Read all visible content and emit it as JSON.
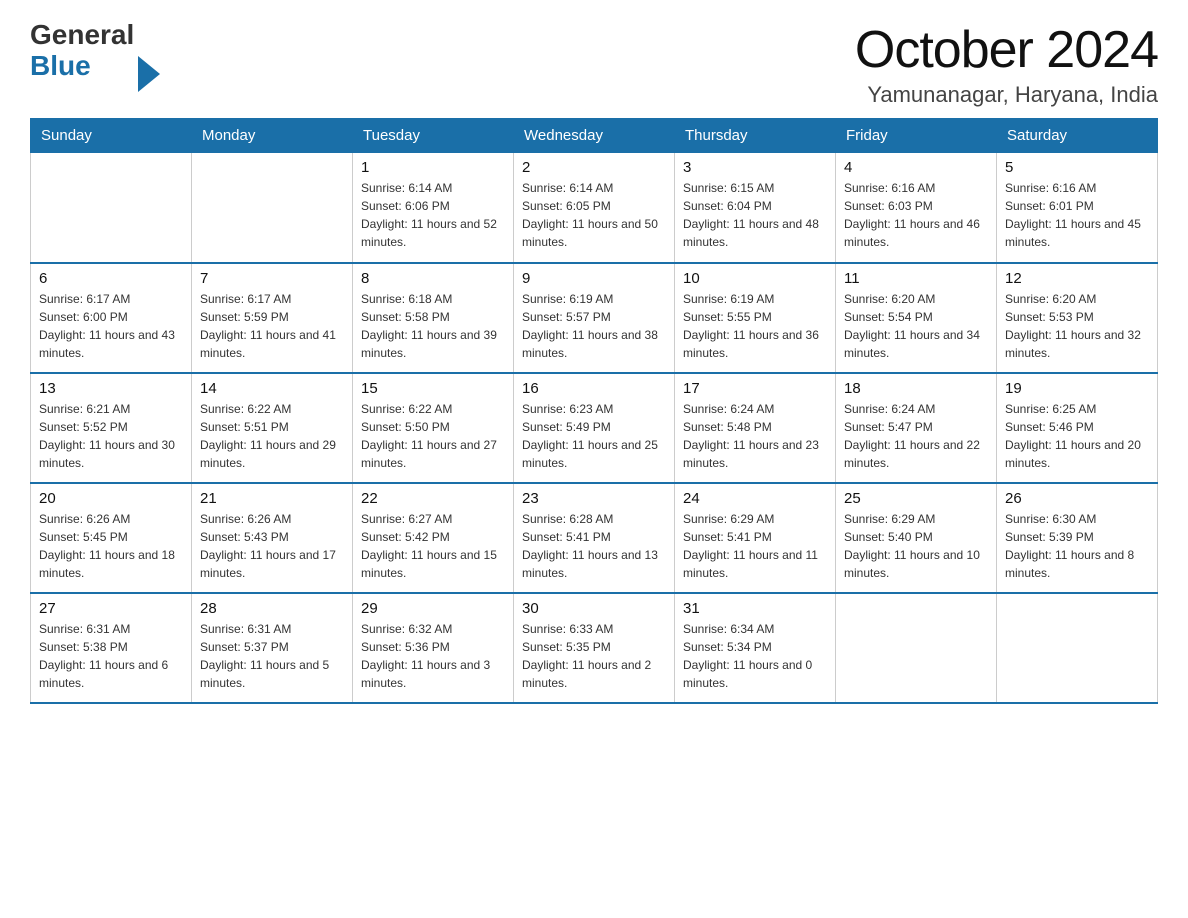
{
  "logo": {
    "general": "General",
    "blue": "Blue"
  },
  "title": "October 2024",
  "location": "Yamunanagar, Haryana, India",
  "weekdays": [
    "Sunday",
    "Monday",
    "Tuesday",
    "Wednesday",
    "Thursday",
    "Friday",
    "Saturday"
  ],
  "weeks": [
    [
      {
        "day": "",
        "sunrise": "",
        "sunset": "",
        "daylight": ""
      },
      {
        "day": "",
        "sunrise": "",
        "sunset": "",
        "daylight": ""
      },
      {
        "day": "1",
        "sunrise": "Sunrise: 6:14 AM",
        "sunset": "Sunset: 6:06 PM",
        "daylight": "Daylight: 11 hours and 52 minutes."
      },
      {
        "day": "2",
        "sunrise": "Sunrise: 6:14 AM",
        "sunset": "Sunset: 6:05 PM",
        "daylight": "Daylight: 11 hours and 50 minutes."
      },
      {
        "day": "3",
        "sunrise": "Sunrise: 6:15 AM",
        "sunset": "Sunset: 6:04 PM",
        "daylight": "Daylight: 11 hours and 48 minutes."
      },
      {
        "day": "4",
        "sunrise": "Sunrise: 6:16 AM",
        "sunset": "Sunset: 6:03 PM",
        "daylight": "Daylight: 11 hours and 46 minutes."
      },
      {
        "day": "5",
        "sunrise": "Sunrise: 6:16 AM",
        "sunset": "Sunset: 6:01 PM",
        "daylight": "Daylight: 11 hours and 45 minutes."
      }
    ],
    [
      {
        "day": "6",
        "sunrise": "Sunrise: 6:17 AM",
        "sunset": "Sunset: 6:00 PM",
        "daylight": "Daylight: 11 hours and 43 minutes."
      },
      {
        "day": "7",
        "sunrise": "Sunrise: 6:17 AM",
        "sunset": "Sunset: 5:59 PM",
        "daylight": "Daylight: 11 hours and 41 minutes."
      },
      {
        "day": "8",
        "sunrise": "Sunrise: 6:18 AM",
        "sunset": "Sunset: 5:58 PM",
        "daylight": "Daylight: 11 hours and 39 minutes."
      },
      {
        "day": "9",
        "sunrise": "Sunrise: 6:19 AM",
        "sunset": "Sunset: 5:57 PM",
        "daylight": "Daylight: 11 hours and 38 minutes."
      },
      {
        "day": "10",
        "sunrise": "Sunrise: 6:19 AM",
        "sunset": "Sunset: 5:55 PM",
        "daylight": "Daylight: 11 hours and 36 minutes."
      },
      {
        "day": "11",
        "sunrise": "Sunrise: 6:20 AM",
        "sunset": "Sunset: 5:54 PM",
        "daylight": "Daylight: 11 hours and 34 minutes."
      },
      {
        "day": "12",
        "sunrise": "Sunrise: 6:20 AM",
        "sunset": "Sunset: 5:53 PM",
        "daylight": "Daylight: 11 hours and 32 minutes."
      }
    ],
    [
      {
        "day": "13",
        "sunrise": "Sunrise: 6:21 AM",
        "sunset": "Sunset: 5:52 PM",
        "daylight": "Daylight: 11 hours and 30 minutes."
      },
      {
        "day": "14",
        "sunrise": "Sunrise: 6:22 AM",
        "sunset": "Sunset: 5:51 PM",
        "daylight": "Daylight: 11 hours and 29 minutes."
      },
      {
        "day": "15",
        "sunrise": "Sunrise: 6:22 AM",
        "sunset": "Sunset: 5:50 PM",
        "daylight": "Daylight: 11 hours and 27 minutes."
      },
      {
        "day": "16",
        "sunrise": "Sunrise: 6:23 AM",
        "sunset": "Sunset: 5:49 PM",
        "daylight": "Daylight: 11 hours and 25 minutes."
      },
      {
        "day": "17",
        "sunrise": "Sunrise: 6:24 AM",
        "sunset": "Sunset: 5:48 PM",
        "daylight": "Daylight: 11 hours and 23 minutes."
      },
      {
        "day": "18",
        "sunrise": "Sunrise: 6:24 AM",
        "sunset": "Sunset: 5:47 PM",
        "daylight": "Daylight: 11 hours and 22 minutes."
      },
      {
        "day": "19",
        "sunrise": "Sunrise: 6:25 AM",
        "sunset": "Sunset: 5:46 PM",
        "daylight": "Daylight: 11 hours and 20 minutes."
      }
    ],
    [
      {
        "day": "20",
        "sunrise": "Sunrise: 6:26 AM",
        "sunset": "Sunset: 5:45 PM",
        "daylight": "Daylight: 11 hours and 18 minutes."
      },
      {
        "day": "21",
        "sunrise": "Sunrise: 6:26 AM",
        "sunset": "Sunset: 5:43 PM",
        "daylight": "Daylight: 11 hours and 17 minutes."
      },
      {
        "day": "22",
        "sunrise": "Sunrise: 6:27 AM",
        "sunset": "Sunset: 5:42 PM",
        "daylight": "Daylight: 11 hours and 15 minutes."
      },
      {
        "day": "23",
        "sunrise": "Sunrise: 6:28 AM",
        "sunset": "Sunset: 5:41 PM",
        "daylight": "Daylight: 11 hours and 13 minutes."
      },
      {
        "day": "24",
        "sunrise": "Sunrise: 6:29 AM",
        "sunset": "Sunset: 5:41 PM",
        "daylight": "Daylight: 11 hours and 11 minutes."
      },
      {
        "day": "25",
        "sunrise": "Sunrise: 6:29 AM",
        "sunset": "Sunset: 5:40 PM",
        "daylight": "Daylight: 11 hours and 10 minutes."
      },
      {
        "day": "26",
        "sunrise": "Sunrise: 6:30 AM",
        "sunset": "Sunset: 5:39 PM",
        "daylight": "Daylight: 11 hours and 8 minutes."
      }
    ],
    [
      {
        "day": "27",
        "sunrise": "Sunrise: 6:31 AM",
        "sunset": "Sunset: 5:38 PM",
        "daylight": "Daylight: 11 hours and 6 minutes."
      },
      {
        "day": "28",
        "sunrise": "Sunrise: 6:31 AM",
        "sunset": "Sunset: 5:37 PM",
        "daylight": "Daylight: 11 hours and 5 minutes."
      },
      {
        "day": "29",
        "sunrise": "Sunrise: 6:32 AM",
        "sunset": "Sunset: 5:36 PM",
        "daylight": "Daylight: 11 hours and 3 minutes."
      },
      {
        "day": "30",
        "sunrise": "Sunrise: 6:33 AM",
        "sunset": "Sunset: 5:35 PM",
        "daylight": "Daylight: 11 hours and 2 minutes."
      },
      {
        "day": "31",
        "sunrise": "Sunrise: 6:34 AM",
        "sunset": "Sunset: 5:34 PM",
        "daylight": "Daylight: 11 hours and 0 minutes."
      },
      {
        "day": "",
        "sunrise": "",
        "sunset": "",
        "daylight": ""
      },
      {
        "day": "",
        "sunrise": "",
        "sunset": "",
        "daylight": ""
      }
    ]
  ]
}
